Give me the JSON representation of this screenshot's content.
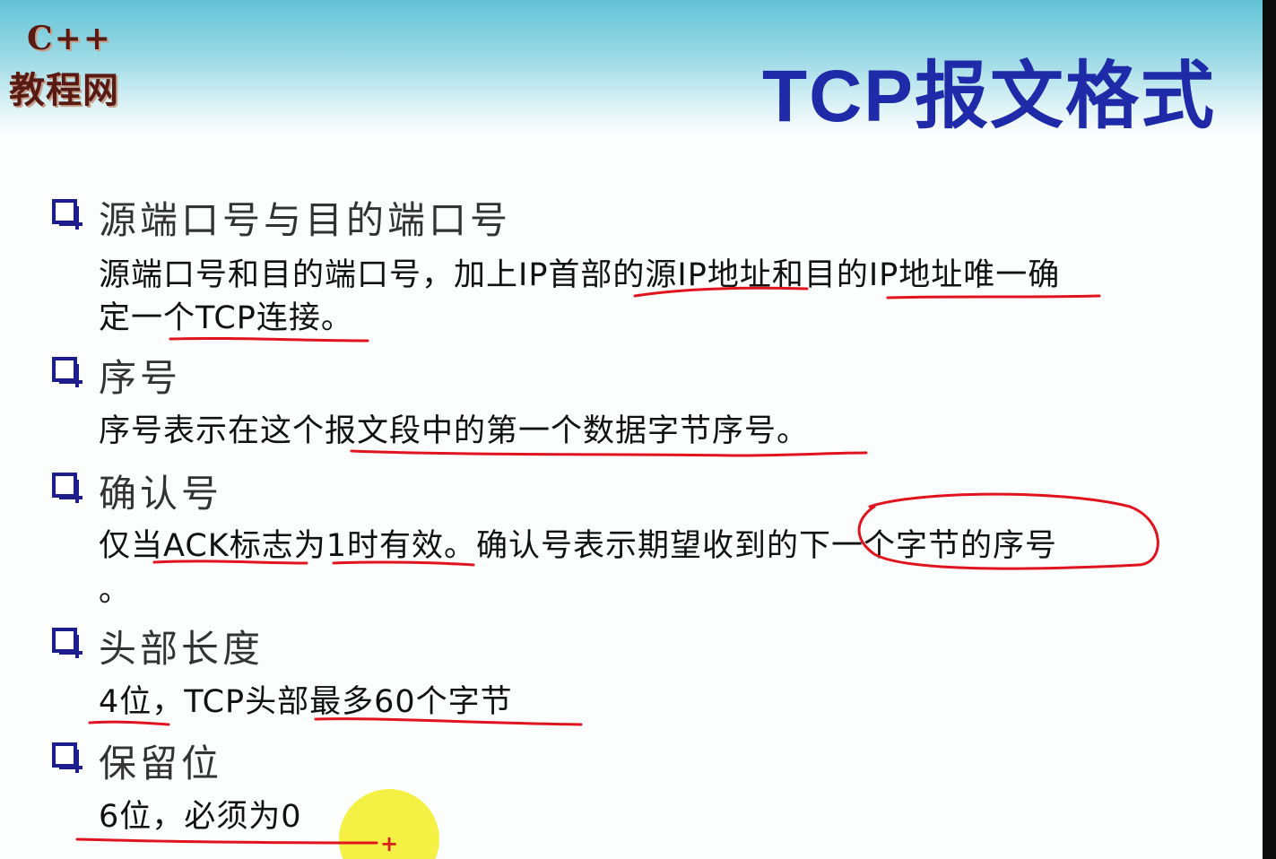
{
  "logo": {
    "cpp": "C++",
    "site": "教程网"
  },
  "title": "TCP报文格式",
  "sections": [
    {
      "heading": "源端口号与目的端口号",
      "lines": [
        "源端口号和目的端口号，加上IP首部的源IP地址和目的IP地址唯一确",
        "定一个TCP连接。"
      ]
    },
    {
      "heading": "序号",
      "lines": [
        "序号表示在这个报文段中的第一个数据字节序号。"
      ]
    },
    {
      "heading": "确认号",
      "lines": [
        "仅当ACK标志为1时有效。确认号表示期望收到的下一个字节的序号",
        "。"
      ]
    },
    {
      "heading": "头部长度",
      "lines": [
        "4位，TCP头部最多60个字节"
      ]
    },
    {
      "heading": "保留位",
      "lines": [
        "6位，必须为0"
      ]
    }
  ],
  "colors": {
    "title": "#1f2aa8",
    "bullet": "#1d1d8c",
    "annotation": "#e0141e",
    "cursor_highlight": "#f4ef3a"
  },
  "icons": {
    "bullet": "checkbox-square-icon",
    "cursor": "cursor-crosshair-icon"
  }
}
